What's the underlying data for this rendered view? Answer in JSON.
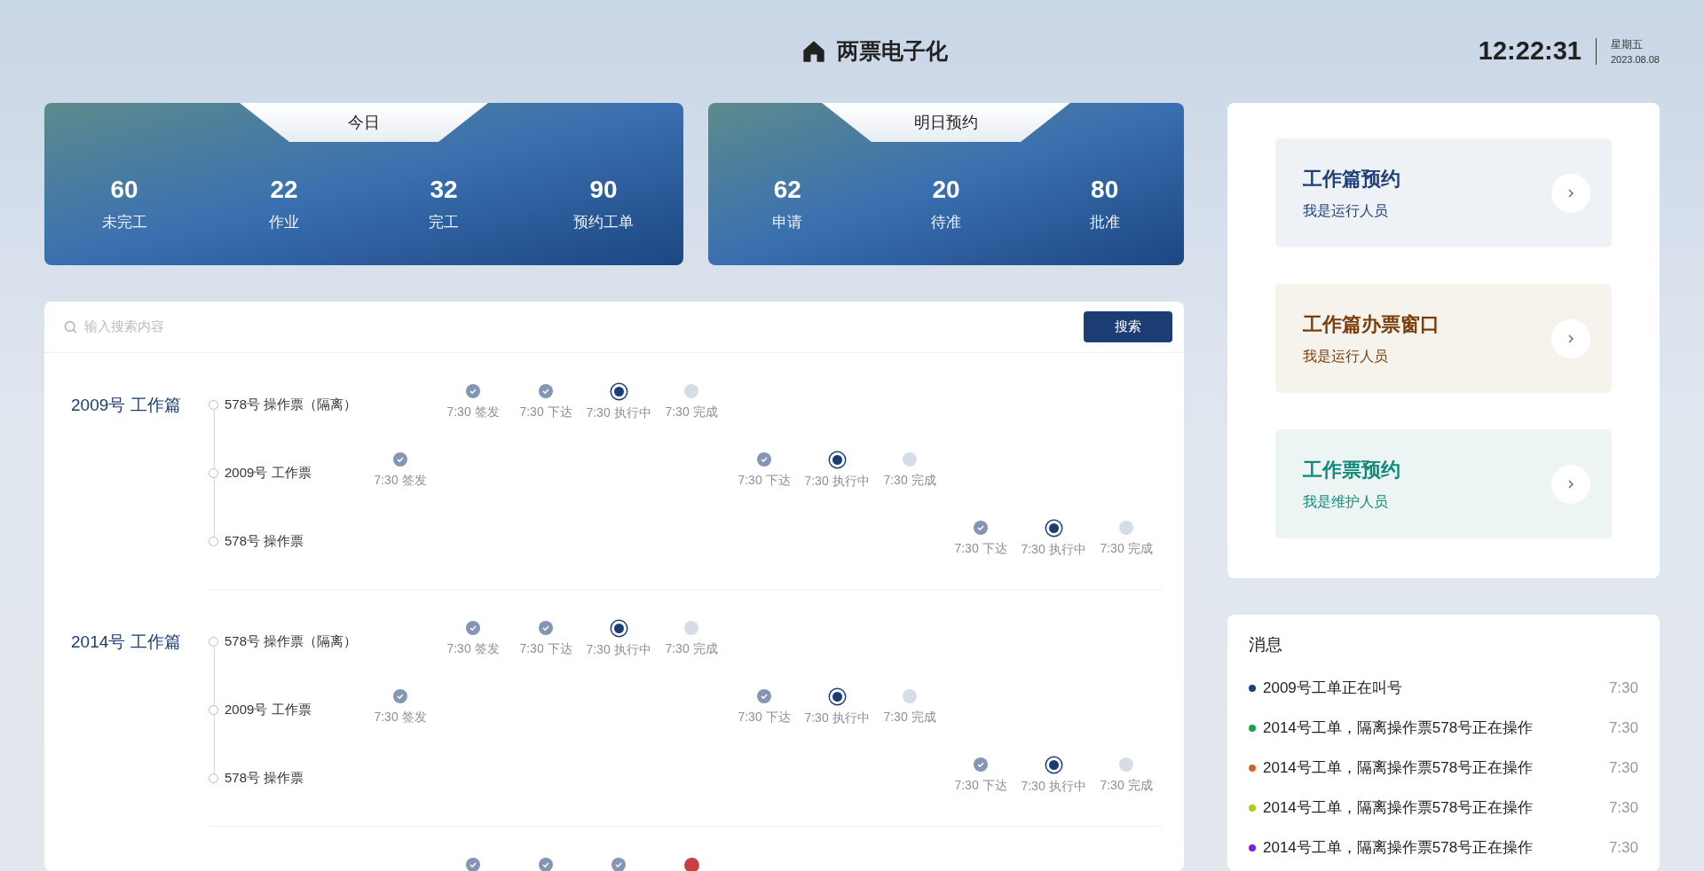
{
  "header": {
    "title": "两票电子化",
    "time": "12:22:31",
    "weekday": "星期五",
    "date": "2023.08.08"
  },
  "summary_cards": [
    {
      "title": "今日",
      "stats": [
        {
          "value": "60",
          "label": "未完工"
        },
        {
          "value": "22",
          "label": "作业"
        },
        {
          "value": "32",
          "label": "完工"
        },
        {
          "value": "90",
          "label": "预约工单"
        }
      ]
    },
    {
      "title": "明日预约",
      "stats": [
        {
          "value": "62",
          "label": "申请"
        },
        {
          "value": "20",
          "label": "待准"
        },
        {
          "value": "80",
          "label": "批准"
        }
      ]
    }
  ],
  "search": {
    "placeholder": "输入搜索内容",
    "button": "搜索"
  },
  "work_orders": [
    {
      "title": "2009号 工作篇",
      "tickets": [
        {
          "name": "578号 操作票（隔离）",
          "steps": [
            {
              "kind": "done",
              "label": "7:30 签发"
            },
            {
              "kind": "done",
              "label": "7:30 下达"
            },
            {
              "kind": "current",
              "label": "7:30 执行中"
            },
            {
              "kind": "pending",
              "label": "7:30 完成"
            }
          ]
        },
        {
          "name": "2009号 工作票",
          "steps": [
            {
              "kind": "done",
              "label": "7:30 签发"
            },
            {
              "kind": "done",
              "label": "7:30 下达"
            },
            {
              "kind": "current",
              "label": "7:30 执行中"
            },
            {
              "kind": "pending",
              "label": "7:30 完成"
            }
          ]
        },
        {
          "name": "578号 操作票",
          "steps": [
            {
              "kind": "done",
              "label": "7:30 下达"
            },
            {
              "kind": "current",
              "label": "7:30 执行中"
            },
            {
              "kind": "pending",
              "label": "7:30 完成"
            }
          ]
        }
      ]
    },
    {
      "title": "2014号 工作篇",
      "tickets": [
        {
          "name": "578号 操作票（隔离）",
          "steps": [
            {
              "kind": "done",
              "label": "7:30 签发"
            },
            {
              "kind": "done",
              "label": "7:30 下达"
            },
            {
              "kind": "current",
              "label": "7:30 执行中"
            },
            {
              "kind": "pending",
              "label": "7:30 完成"
            }
          ]
        },
        {
          "name": "2009号 工作票",
          "steps": [
            {
              "kind": "done",
              "label": "7:30 签发"
            },
            {
              "kind": "done",
              "label": "7:30 下达"
            },
            {
              "kind": "current",
              "label": "7:30 执行中"
            },
            {
              "kind": "pending",
              "label": "7:30 完成"
            }
          ]
        },
        {
          "name": "578号 操作票",
          "steps": [
            {
              "kind": "done",
              "label": "7:30 下达"
            },
            {
              "kind": "current",
              "label": "7:30 执行中"
            },
            {
              "kind": "pending",
              "label": "7:30 完成"
            }
          ]
        }
      ]
    },
    {
      "tickets": [
        {
          "steps": [
            {
              "kind": "done"
            },
            {
              "kind": "done"
            },
            {
              "kind": "done"
            },
            {
              "kind": "error"
            }
          ]
        }
      ]
    }
  ],
  "shortcuts": [
    {
      "title": "工作篇预约",
      "subtitle": "我是运行人员",
      "color": "#1e3f7a"
    },
    {
      "title": "工作篇办票窗口",
      "subtitle": "我是运行人员",
      "color": "#7a3e0a"
    },
    {
      "title": "工作票预约",
      "subtitle": "我是维护人员",
      "color": "#0f8a7a"
    }
  ],
  "messages": {
    "title": "消息",
    "items": [
      {
        "text": "2009号工单正在叫号",
        "time": "7:30",
        "color": "#1e3f7a"
      },
      {
        "text": "2014号工单，隔离操作票578号正在操作",
        "time": "7:30",
        "color": "#16a34a"
      },
      {
        "text": "2014号工单，隔离操作票578号正在操作",
        "time": "7:30",
        "color": "#d4622a"
      },
      {
        "text": "2014号工单，隔离操作票578号正在操作",
        "time": "7:30",
        "color": "#b5c91a"
      },
      {
        "text": "2014号工单，隔离操作票578号正在操作",
        "time": "7:30",
        "color": "#7e22ce"
      }
    ]
  }
}
